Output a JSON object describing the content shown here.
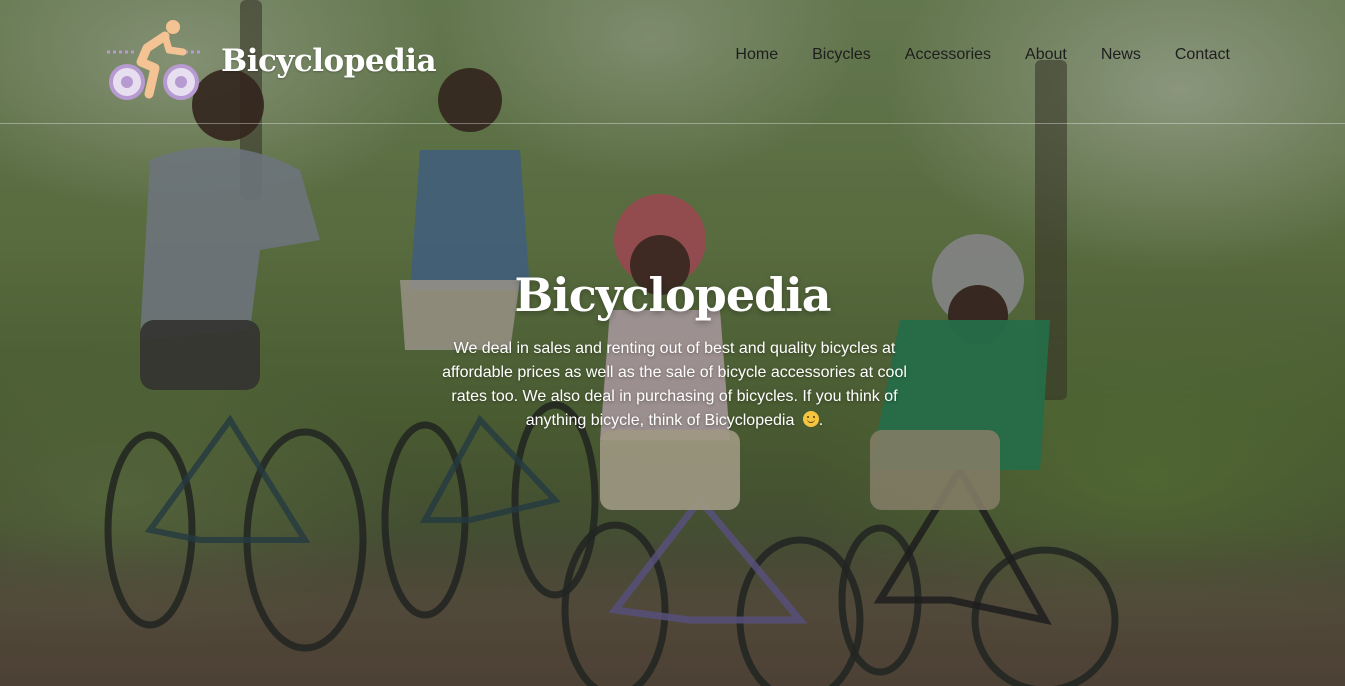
{
  "brand": {
    "name": "Bicyclopedia",
    "logo_icon": "cyclist-icon"
  },
  "nav": {
    "items": [
      {
        "label": "Home"
      },
      {
        "label": "Bicycles"
      },
      {
        "label": "Accessories"
      },
      {
        "label": "About"
      },
      {
        "label": "News"
      },
      {
        "label": "Contact"
      }
    ]
  },
  "hero": {
    "title": "Bicyclopedia",
    "description": "We deal in sales and renting out of best and quality bicycles at affordable prices as well as the sale of bicycle accessories at cool rates too. We also deal in purchasing of bicycles. If you think of anything bicycle, think of Bicyclopedia",
    "description_end": ".",
    "emoji_icon": "smiley-face-icon"
  },
  "colors": {
    "logo_purple": "#b79ad1",
    "logo_peach": "#f4c393",
    "nav_text": "#1e1e1e",
    "hero_text": "#ffffff"
  }
}
